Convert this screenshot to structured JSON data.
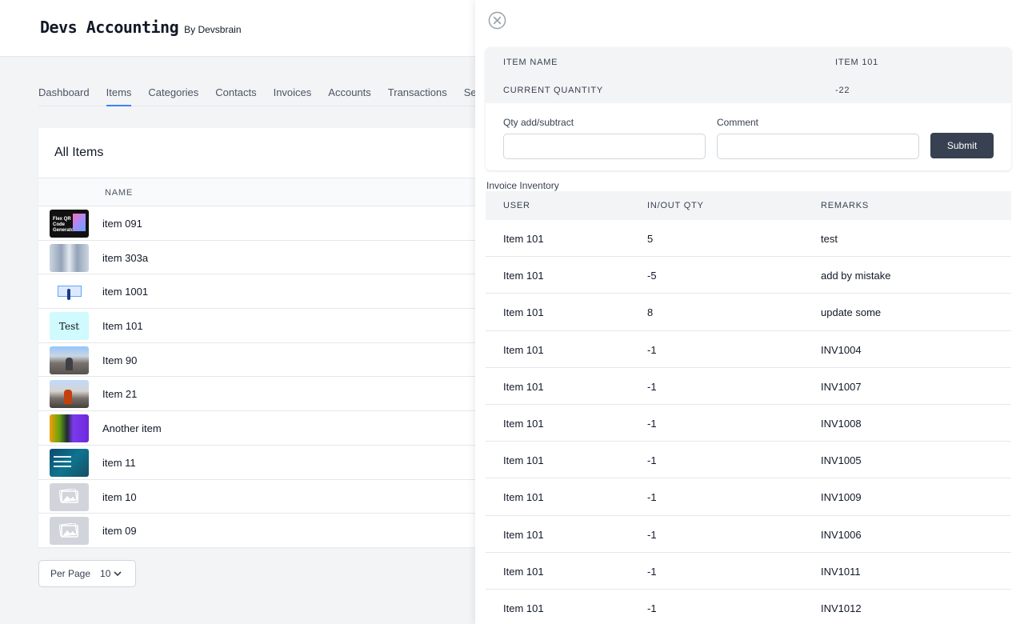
{
  "app": {
    "title": "Devs Accounting",
    "subtitle": "By Devsbrain"
  },
  "nav": {
    "items": [
      {
        "label": "Dashboard",
        "active": false
      },
      {
        "label": "Items",
        "active": true
      },
      {
        "label": "Categories",
        "active": false
      },
      {
        "label": "Contacts",
        "active": false
      },
      {
        "label": "Invoices",
        "active": false
      },
      {
        "label": "Accounts",
        "active": false
      },
      {
        "label": "Transactions",
        "active": false
      },
      {
        "label": "Se",
        "active": false
      }
    ]
  },
  "items_list": {
    "title": "All Items",
    "column_name": "NAME",
    "rows": [
      {
        "name": "item 091",
        "thumb_text": "Flex QR Code Generator"
      },
      {
        "name": "item 303a"
      },
      {
        "name": "item 1001"
      },
      {
        "name": "Item 101",
        "thumb_text": "Test"
      },
      {
        "name": "Item 90"
      },
      {
        "name": "Item 21"
      },
      {
        "name": "Another item"
      },
      {
        "name": "item 11"
      },
      {
        "name": "item 10"
      },
      {
        "name": "item 09"
      }
    ],
    "per_page_label": "Per Page",
    "per_page_value": "10"
  },
  "drawer": {
    "item_name_label": "ITEM NAME",
    "item_name_value": "ITEM 101",
    "current_qty_label": "CURRENT QUANTITY",
    "current_qty_value": "-22",
    "qty_field_label": "Qty add/subtract",
    "qty_field_value": "",
    "comment_field_label": "Comment",
    "comment_field_value": "",
    "submit_label": "Submit",
    "inventory_title": "Invoice Inventory",
    "inventory_columns": [
      "USER",
      "IN/OUT QTY",
      "REMARKS"
    ],
    "inventory_rows": [
      {
        "user": "Item 101",
        "qty": "5",
        "remarks": "test"
      },
      {
        "user": "Item 101",
        "qty": "-5",
        "remarks": "add by mistake"
      },
      {
        "user": "Item 101",
        "qty": "8",
        "remarks": "update some"
      },
      {
        "user": "Item 101",
        "qty": "-1",
        "remarks": "INV1004"
      },
      {
        "user": "Item 101",
        "qty": "-1",
        "remarks": "INV1007"
      },
      {
        "user": "Item 101",
        "qty": "-1",
        "remarks": "INV1008"
      },
      {
        "user": "Item 101",
        "qty": "-1",
        "remarks": "INV1005"
      },
      {
        "user": "Item 101",
        "qty": "-1",
        "remarks": "INV1009"
      },
      {
        "user": "Item 101",
        "qty": "-1",
        "remarks": "INV1006"
      },
      {
        "user": "Item 101",
        "qty": "-1",
        "remarks": "INV1011"
      },
      {
        "user": "Item 101",
        "qty": "-1",
        "remarks": "INV1012"
      }
    ]
  },
  "colors": {
    "accent": "#3b82f6",
    "button": "#374151"
  }
}
